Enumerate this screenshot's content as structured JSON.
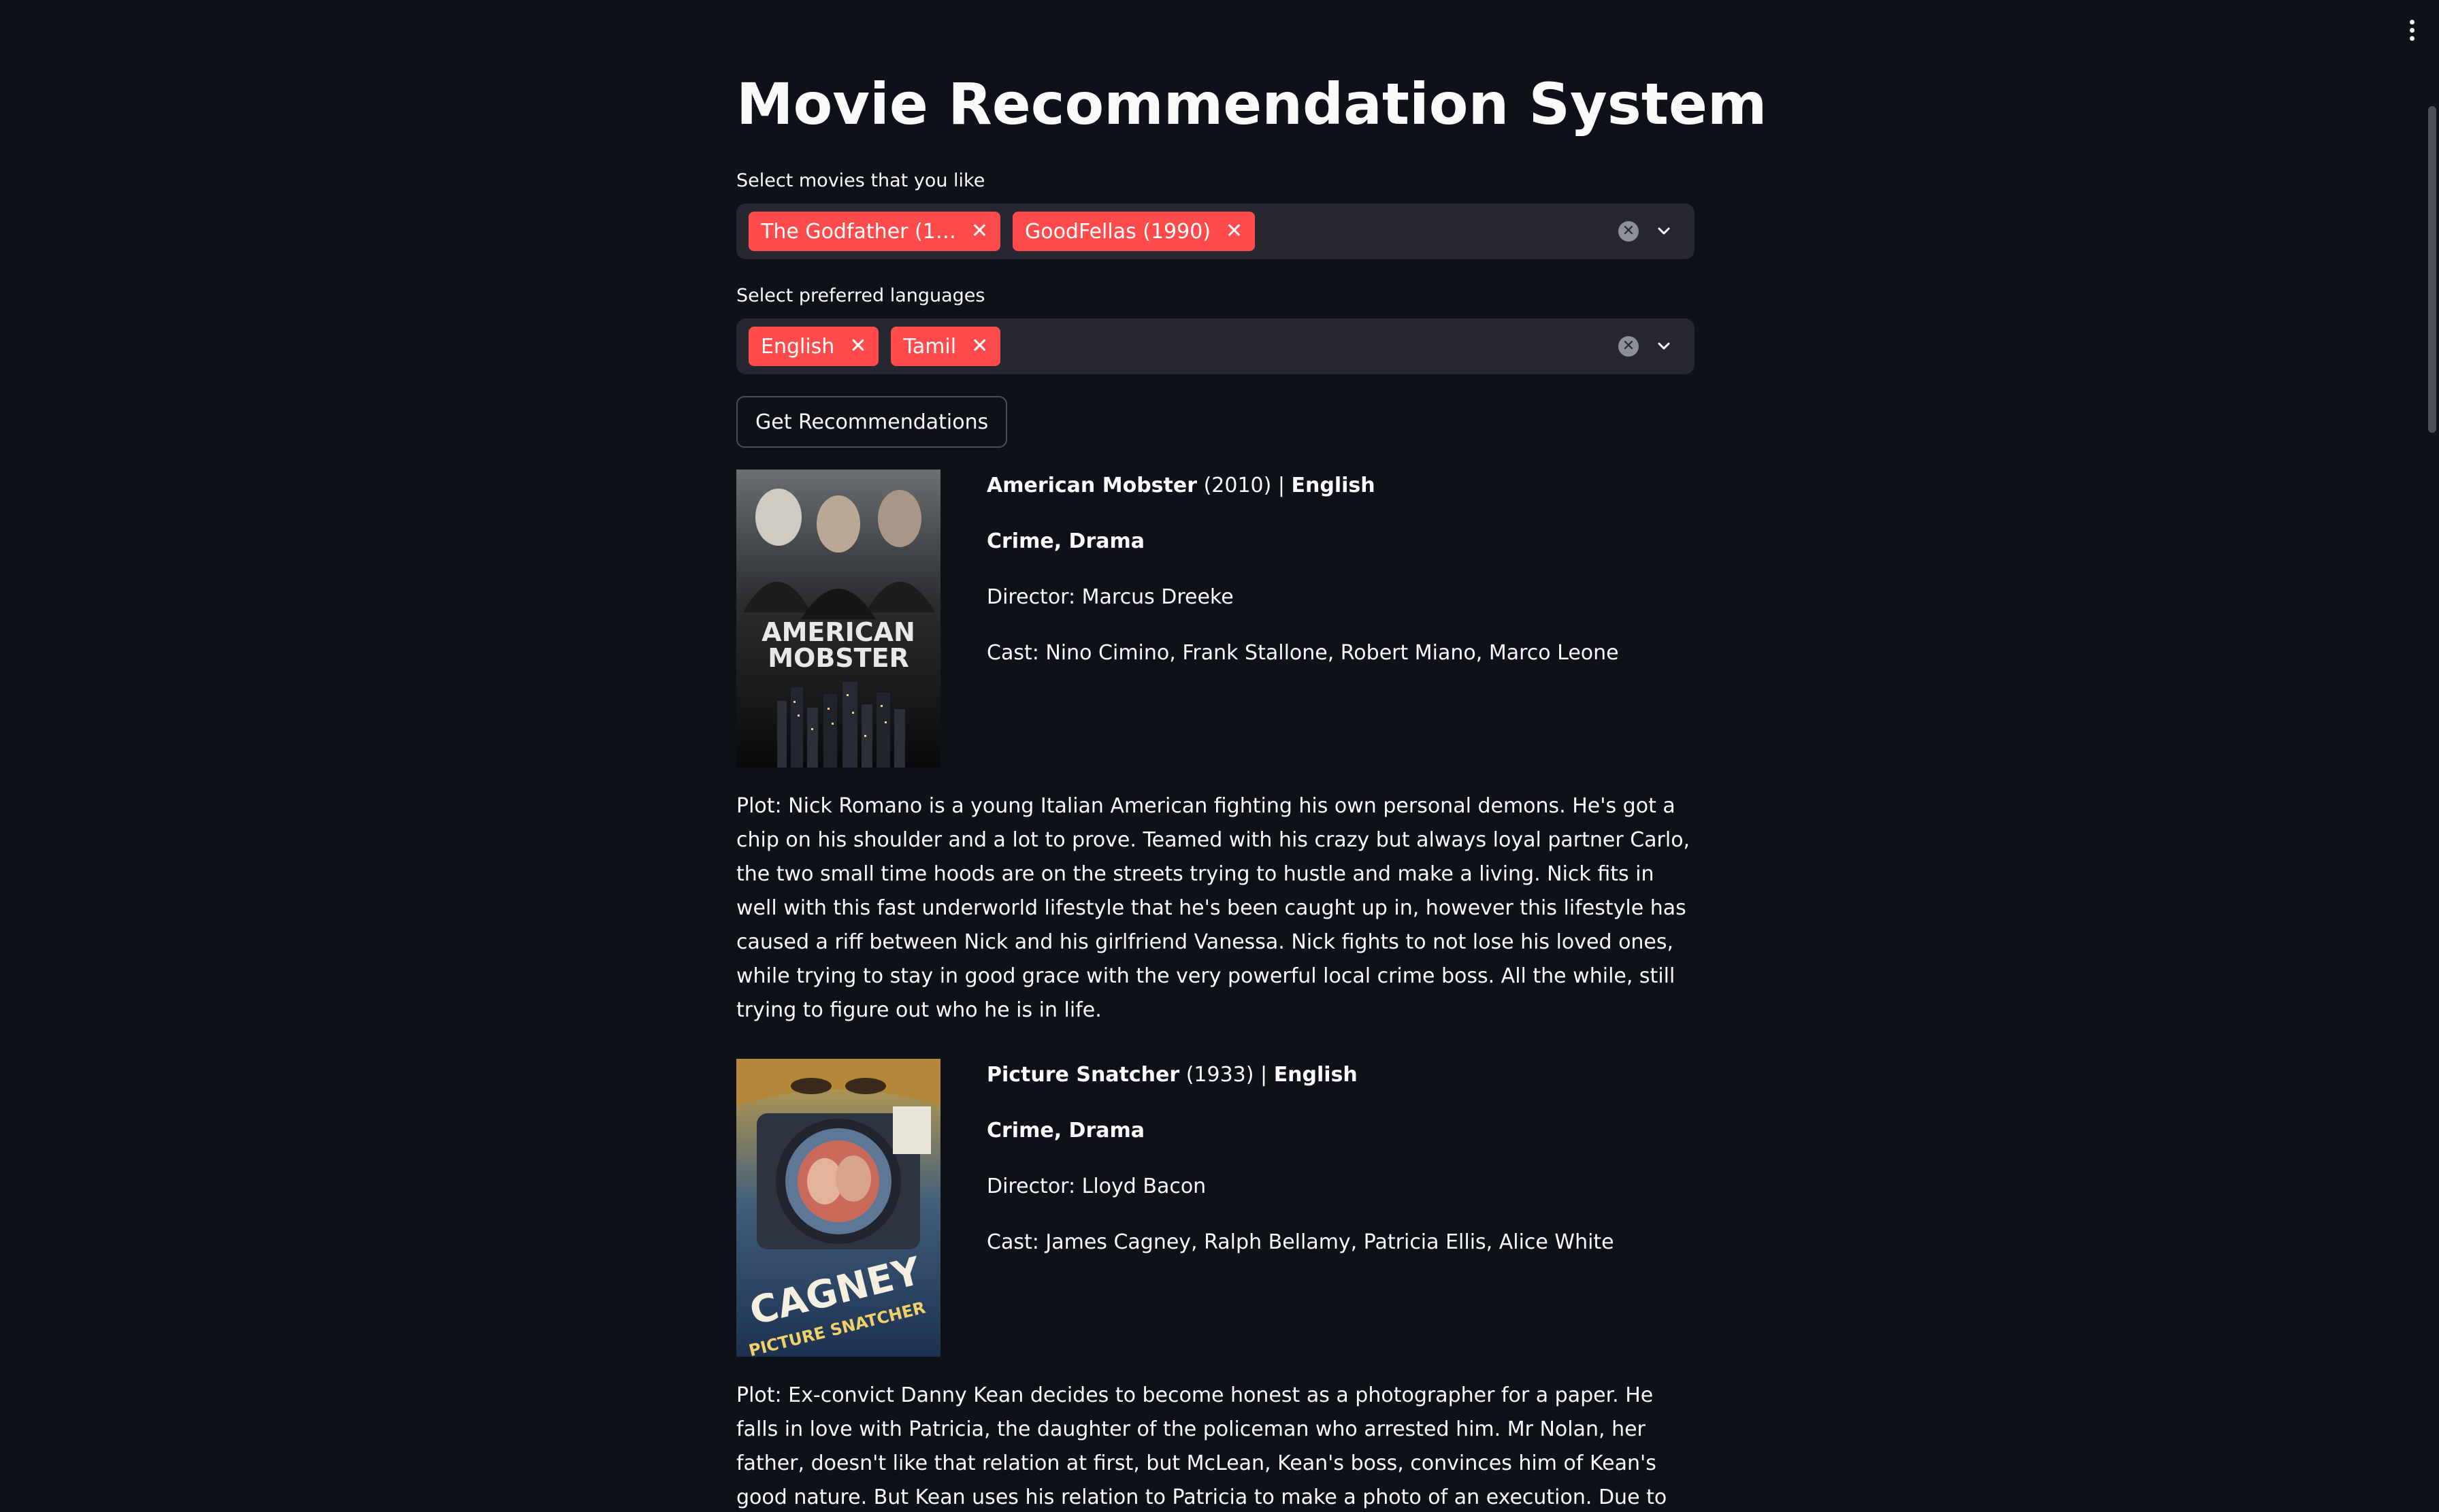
{
  "app": {
    "title": "Movie Recommendation System"
  },
  "movies_select": {
    "label": "Select movies that you like",
    "selected": [
      "The Godfather (1…",
      "GoodFellas (1990)"
    ]
  },
  "languages_select": {
    "label": "Select preferred languages",
    "selected": [
      "English",
      "Tamil"
    ]
  },
  "recommend_button": {
    "label": "Get Recommendations"
  },
  "recommendations": [
    {
      "title": "American Mobster",
      "year": "(2010)",
      "separator": "|",
      "language": "English",
      "genres": "Crime, Drama",
      "director": "Director: Marcus Dreeke",
      "cast": "Cast: Nino Cimino, Frank Stallone, Robert Miano, Marco Leone",
      "poster_text": [
        "AMERICAN",
        "MOBSTER"
      ],
      "plot": "Plot: Nick Romano is a young Italian American fighting his own personal demons. He's got a chip on his shoulder and a lot to prove. Teamed with his crazy but always loyal partner Carlo, the two small time hoods are on the streets trying to hustle and make a living. Nick fits in well with this fast underworld lifestyle that he's been caught up in, however this lifestyle has caused a riff between Nick and his girlfriend Vanessa. Nick fights to not lose his loved ones, while trying to stay in good grace with the very powerful local crime boss. All the while, still trying to figure out who he is in life."
    },
    {
      "title": "Picture Snatcher",
      "year": "(1933)",
      "separator": "|",
      "language": "English",
      "genres": "Crime, Drama",
      "director": "Director: Lloyd Bacon",
      "cast": "Cast: James Cagney, Ralph Bellamy, Patricia Ellis, Alice White",
      "poster_text": [
        "CAGNEY",
        "PICTURE SNATCHER"
      ],
      "plot": "Plot: Ex-convict Danny Kean decides to become honest as a photographer for a paper. He falls in love with Patricia, the daughter of the policeman who arrested him. Mr Nolan, her father, doesn't like that relation at first, but McLean, Kean's boss, convinces him of Kean's good nature. But Kean uses his relation to Patricia to make a photo of an execution. Due to this, Nolan loses his stripes and Kean isn't allowed to see"
    }
  ],
  "colors": {
    "background": "#0e1117",
    "input_bg": "#262730",
    "tag": "#ff4b4b",
    "text": "#fafafa"
  }
}
